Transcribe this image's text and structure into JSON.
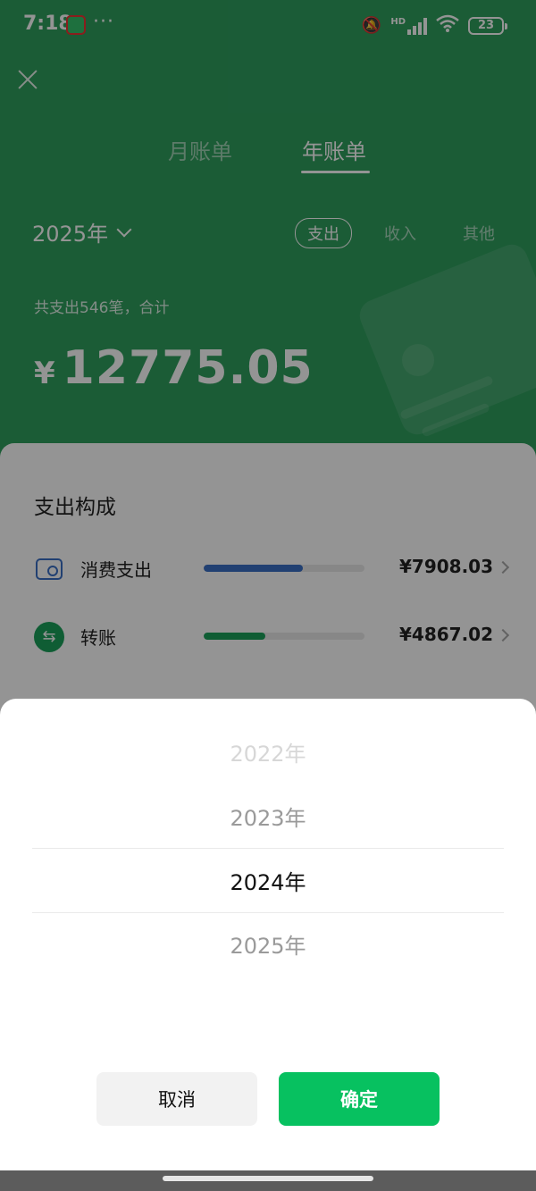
{
  "status_bar": {
    "time": "7:18",
    "dots": "···",
    "hd": "HD",
    "battery": "23"
  },
  "header": {
    "tabs": [
      {
        "label": "月账单",
        "active": false
      },
      {
        "label": "年账单",
        "active": true
      }
    ],
    "year_select": "2025年",
    "filters": [
      "支出",
      "收入",
      "其他"
    ],
    "active_filter": "支出"
  },
  "summary": {
    "label": "共支出546笔，合计",
    "currency": "¥",
    "amount": "12775.05"
  },
  "composition": {
    "title": "支出构成",
    "items": [
      {
        "label": "消费支出",
        "value": "¥7908.03",
        "share": 0.619,
        "color": "#3a6fc4",
        "icon": "wallet-icon"
      },
      {
        "label": "转账",
        "value": "¥4867.02",
        "share": 0.381,
        "color": "#1aa05a",
        "icon": "transfer-icon"
      }
    ]
  },
  "picker": {
    "options": [
      "2022年",
      "2023年",
      "2024年",
      "2025年"
    ],
    "selected": "2024年",
    "cancel_label": "取消",
    "confirm_label": "确定"
  },
  "colors": {
    "brand_green": "#07c160",
    "header_green": "#2f9f5e"
  }
}
